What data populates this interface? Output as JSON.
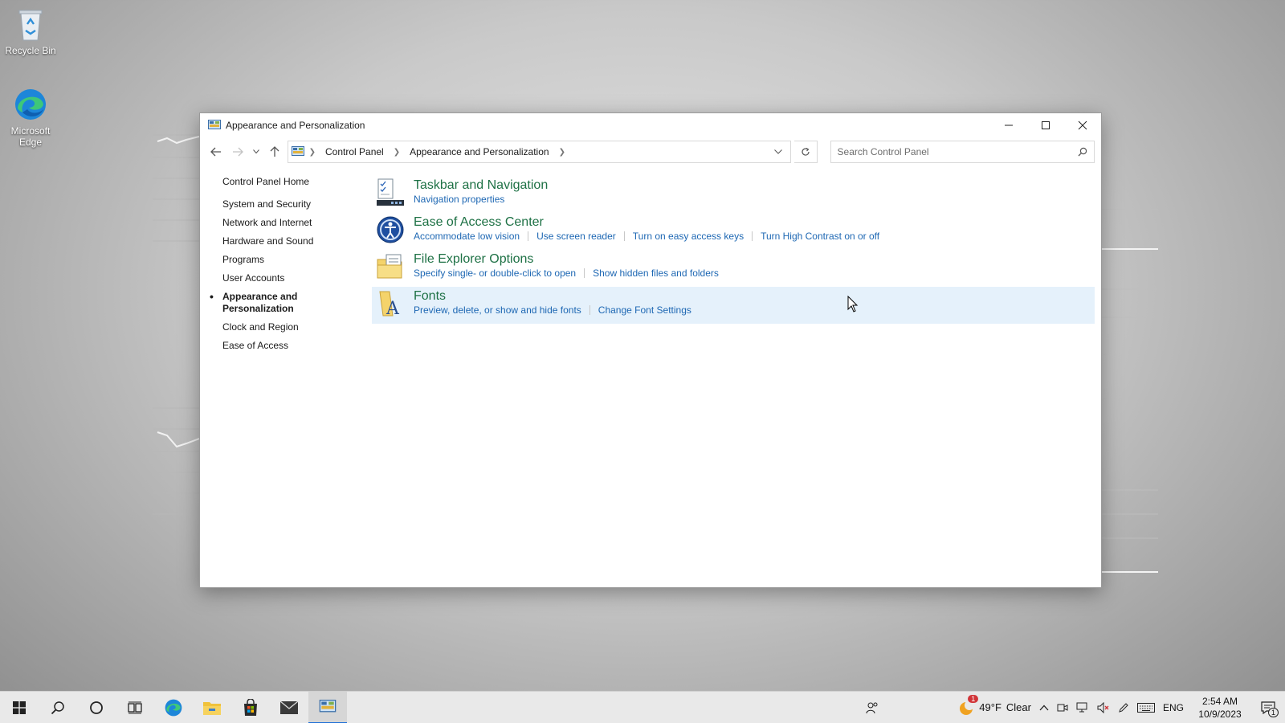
{
  "desktop": {
    "icons": [
      {
        "label": "Recycle Bin",
        "icon": "recycle-bin-icon"
      },
      {
        "label": "Microsoft Edge",
        "icon": "edge-icon"
      }
    ]
  },
  "window": {
    "title": "Appearance and Personalization",
    "controls": {
      "minimize": "minimize-icon",
      "maximize": "maximize-icon",
      "close": "close-icon"
    }
  },
  "address": {
    "breadcrumbs": [
      "Control Panel",
      "Appearance and Personalization"
    ],
    "search_placeholder": "Search Control Panel"
  },
  "left_nav": {
    "home": "Control Panel Home",
    "items": [
      {
        "label": "System and Security",
        "active": false
      },
      {
        "label": "Network and Internet",
        "active": false
      },
      {
        "label": "Hardware and Sound",
        "active": false
      },
      {
        "label": "Programs",
        "active": false
      },
      {
        "label": "User Accounts",
        "active": false
      },
      {
        "label": "Appearance and Personalization",
        "active": true
      },
      {
        "label": "Clock and Region",
        "active": false
      },
      {
        "label": "Ease of Access",
        "active": false
      }
    ]
  },
  "categories": [
    {
      "title": "Taskbar and Navigation",
      "icon": "taskbar-icon",
      "links": [
        "Navigation properties"
      ]
    },
    {
      "title": "Ease of Access Center",
      "icon": "ease-of-access-icon",
      "links": [
        "Accommodate low vision",
        "Use screen reader",
        "Turn on easy access keys",
        "Turn High Contrast on or off"
      ]
    },
    {
      "title": "File Explorer Options",
      "icon": "folder-options-icon",
      "links": [
        "Specify single- or double-click to open",
        "Show hidden files and folders"
      ]
    },
    {
      "title": "Fonts",
      "icon": "fonts-icon",
      "links": [
        "Preview, delete, or show and hide fonts",
        "Change Font Settings"
      ],
      "hovered": true
    }
  ],
  "taskbar": {
    "weather": {
      "temp": "49°F",
      "condition": "Clear",
      "badge": "1"
    },
    "language": "ENG",
    "time": "2:54 AM",
    "date": "10/9/2023",
    "notification_badge": "1"
  },
  "colors": {
    "category_title": "#1e7145",
    "link": "#1d67b3",
    "hover_row": "#e5f1fb",
    "taskbar_active": "#1f6fd6"
  }
}
